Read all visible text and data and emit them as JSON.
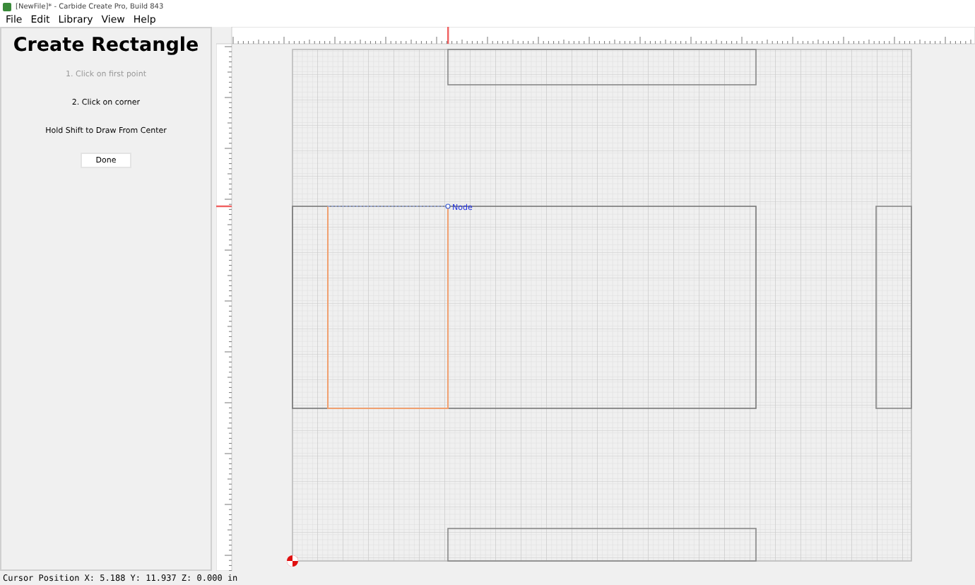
{
  "window": {
    "title": "[NewFile]* - Carbide Create Pro, Build 843"
  },
  "menu": [
    "File",
    "Edit",
    "Library",
    "View",
    "Help"
  ],
  "panel": {
    "heading": "Create Rectangle",
    "steps": [
      {
        "text": "1. Click on first point",
        "completed": true
      },
      {
        "text": "2. Click on corner",
        "completed": false
      }
    ],
    "hint": "Hold Shift to Draw From Center",
    "button": "Done"
  },
  "canvas": {
    "node_label": "Node"
  },
  "status_bar": "Cursor Position X: 5.188 Y: 11.937 Z: 0.000 in"
}
